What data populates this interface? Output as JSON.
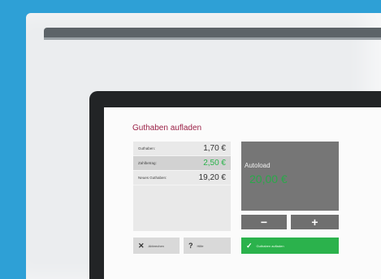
{
  "screen": {
    "title": "Guthaben aufladen"
  },
  "balance_rows": [
    {
      "label": "Guthaben:",
      "value": "1,70 €"
    },
    {
      "label": "Zahlbetrag:",
      "value": "2,50 €"
    },
    {
      "label": "Neues Guthaben:",
      "value": "19,20 €"
    }
  ],
  "autoload": {
    "title": "Autoload",
    "value": "20,00 €"
  },
  "buttons": {
    "minus": "−",
    "plus": "+",
    "cancel_label": "Abbrechen",
    "help_label": "Hilfe",
    "charge_label": "Guthaben aufladen"
  },
  "colors": {
    "background": "#2ea0d6",
    "title": "#9a1f45",
    "accent_green": "#2bb24c",
    "panel_gray": "#767676"
  }
}
